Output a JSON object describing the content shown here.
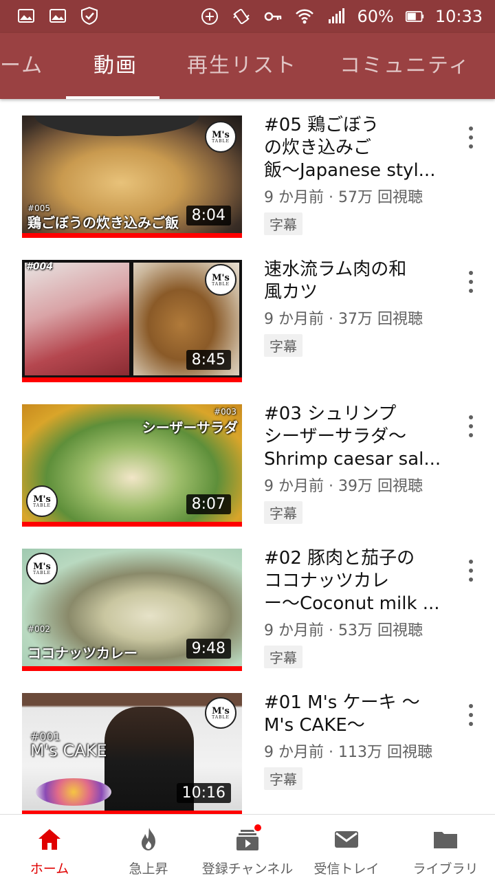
{
  "status_bar": {
    "battery": "60%",
    "time": "10:33",
    "icons": [
      "image-icon",
      "image-icon",
      "shield-check-icon",
      "add-circle-icon",
      "vibrate-icon",
      "key-icon",
      "wifi-icon",
      "signal-icon",
      "battery-icon"
    ]
  },
  "tabs": [
    {
      "label": "ーム",
      "active": false
    },
    {
      "label": "動画",
      "active": true
    },
    {
      "label": "再生リスト",
      "active": false
    },
    {
      "label": "コミュニティ",
      "active": false
    }
  ],
  "videos": [
    {
      "title_lines": [
        "#05 鶏ごぼう",
        "の炊き込みご",
        "飯〜Japanese styl..."
      ],
      "meta": "9 か月前 · 57万 回視聴",
      "badge": "字幕",
      "duration": "8:04",
      "thumb_caption_small": "#005",
      "thumb_caption": "鶏ごぼうの炊き込みご飯",
      "logo": "M's"
    },
    {
      "title_lines": [
        "速水流ラム肉の和",
        "風カツ"
      ],
      "meta": "9 か月前 · 37万 回視聴",
      "badge": "字幕",
      "duration": "8:45",
      "thumb_caption_small": "#004",
      "thumb_caption": "",
      "logo": "M's"
    },
    {
      "title_lines": [
        "#03 シュリンプ",
        "シーザーサラダ〜",
        "Shrimp caesar sal..."
      ],
      "meta": "9 か月前 · 39万 回視聴",
      "badge": "字幕",
      "duration": "8:07",
      "thumb_caption_small": "#003",
      "thumb_caption": "シーザーサラダ",
      "logo": "M's"
    },
    {
      "title_lines": [
        "#02 豚肉と茄子の",
        "ココナッツカレ",
        "ー〜Coconut milk ..."
      ],
      "meta": "9 か月前 · 53万 回視聴",
      "badge": "字幕",
      "duration": "9:48",
      "thumb_caption_small": "#002",
      "thumb_caption": "ココナッツカレー",
      "logo": "M's"
    },
    {
      "title_lines": [
        "#01 M's ケーキ 〜",
        "M's CAKE〜"
      ],
      "meta": "9 か月前 · 113万 回視聴",
      "badge": "字幕",
      "duration": "10:16",
      "thumb_caption_small": "#001",
      "thumb_caption": "M's CAKE",
      "logo": "M's"
    }
  ],
  "bottom_nav": [
    {
      "label": "ホーム",
      "icon": "home-icon",
      "active": true
    },
    {
      "label": "急上昇",
      "icon": "flame-icon",
      "active": false
    },
    {
      "label": "登録チャンネル",
      "icon": "subscriptions-icon",
      "active": false
    },
    {
      "label": "受信トレイ",
      "icon": "mail-icon",
      "active": false
    },
    {
      "label": "ライブラリ",
      "icon": "folder-icon",
      "active": false
    }
  ],
  "colors": {
    "status_bar": "#8e3a3b",
    "tab_bar": "#9a4142",
    "accent_red": "#ff0000",
    "active_nav": "#e00000"
  }
}
